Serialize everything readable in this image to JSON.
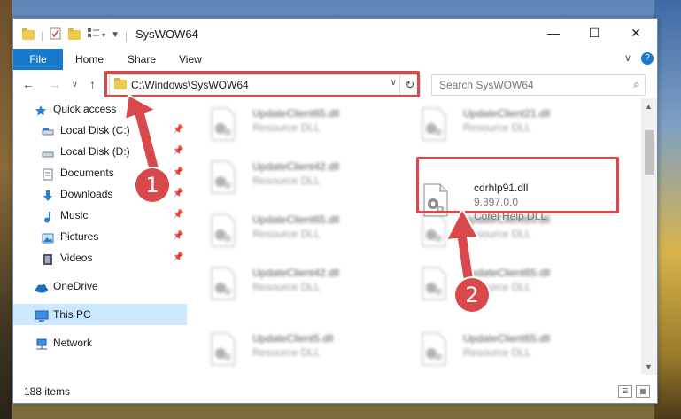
{
  "window": {
    "title": "SysWOW64"
  },
  "ribbon": {
    "file": "File",
    "home": "Home",
    "share": "Share",
    "view": "View",
    "help": "?"
  },
  "address": {
    "path": "C:\\Windows\\SysWOW64"
  },
  "search": {
    "placeholder": "Search SysWOW64"
  },
  "sidebar": {
    "items": [
      {
        "label": "Quick access"
      },
      {
        "label": "Local Disk (C:)"
      },
      {
        "label": "Local Disk (D:)"
      },
      {
        "label": "Documents"
      },
      {
        "label": "Downloads"
      },
      {
        "label": "Music"
      },
      {
        "label": "Pictures"
      },
      {
        "label": "Videos"
      },
      {
        "label": "OneDrive"
      },
      {
        "label": "This PC"
      },
      {
        "label": "Network"
      }
    ]
  },
  "files": {
    "left": [
      {
        "name": "UpdateClient65.dll",
        "type": "Resource DLL"
      },
      {
        "name": "UpdateClient42.dll",
        "type": "Resource DLL"
      },
      {
        "name": "UpdateClient65.dll",
        "type": "Resource DLL"
      },
      {
        "name": "UpdateClient42.dll",
        "type": "Resource DLL"
      },
      {
        "name": "UpdateClient5.dll",
        "type": "Resource DLL"
      }
    ],
    "right": [
      {
        "name": "UpdateClient21.dll",
        "type": "Resource DLL"
      },
      {
        "name": "UpdateClient65.dll",
        "type": "Resource DLL"
      },
      {
        "name": "UpdateClient65.dll",
        "type": "Resource DLL"
      },
      {
        "name": "UpdateClient65.dll",
        "type": "Resource DLL"
      }
    ],
    "highlighted": {
      "name": "cdrhlp91.dll",
      "version": "9.397.0.0",
      "description": "Corel Help DLL"
    }
  },
  "status": {
    "count": "188 items"
  },
  "markers": {
    "one": "1",
    "two": "2"
  },
  "colors": {
    "accent": "#1979ca",
    "highlight_box": "#d9484a",
    "selection": "#cce8ff"
  }
}
